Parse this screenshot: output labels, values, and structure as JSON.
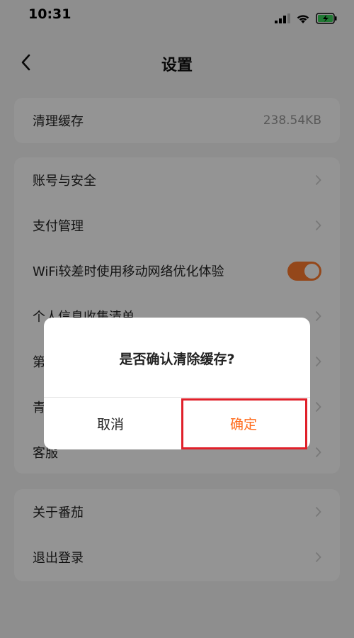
{
  "status_bar": {
    "time": "10:31"
  },
  "nav": {
    "title": "设置"
  },
  "cache_card": {
    "label": "清理缓存",
    "value": "238.54KB"
  },
  "settings": {
    "account": "账号与安全",
    "payment": "支付管理",
    "wifi": "WiFi较差时使用移动网络优化体验",
    "wifi_toggle_on": true,
    "personal_info": "个人信息收集清单",
    "third_party": "第",
    "youth": "青",
    "service": "客服"
  },
  "bottom_card": {
    "about": "关于番茄",
    "logout": "退出登录"
  },
  "dialog": {
    "message": "是否确认清除缓存?",
    "cancel_label": "取消",
    "confirm_label": "确定"
  },
  "colors": {
    "accent": "#ff7a2e",
    "highlight_border": "#e0202a"
  }
}
